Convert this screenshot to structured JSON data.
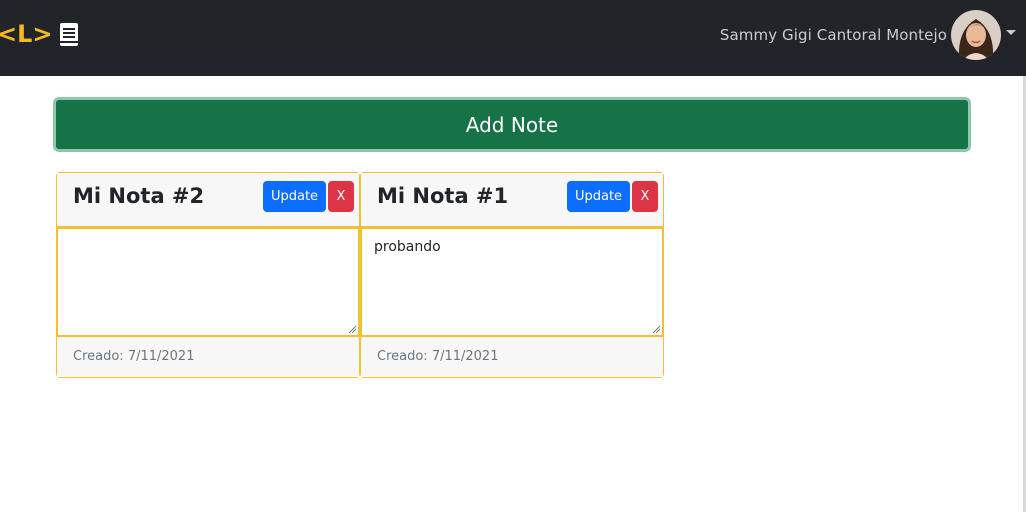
{
  "navbar": {
    "brand_left": "<L>",
    "user_name": "Sammy Gigi Cantoral Montejo"
  },
  "add_note_label": "Add Note",
  "notes": [
    {
      "title": "Mi Nota #2",
      "update_label": "Update",
      "delete_label": "X",
      "content": "",
      "created": "Creado: 7/11/2021"
    },
    {
      "title": "Mi Nota #1",
      "update_label": "Update",
      "delete_label": "X",
      "content": "probando",
      "created": "Creado: 7/11/2021"
    }
  ],
  "colors": {
    "navbar": "#212529",
    "add_button": "#157347",
    "update_button": "#0d6efd",
    "delete_button": "#dc3545",
    "card_border": "#f0c030"
  }
}
